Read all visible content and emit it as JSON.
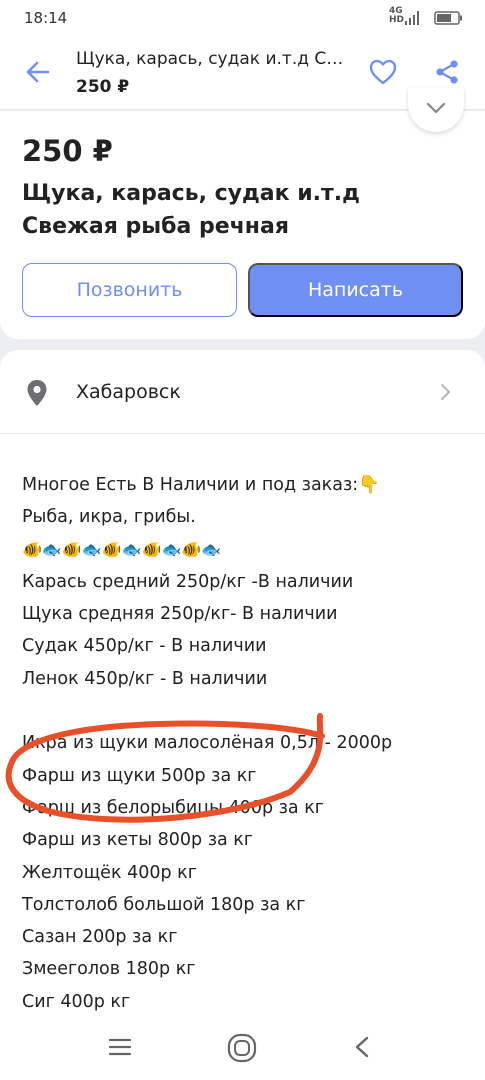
{
  "status_bar": {
    "time": "18:14",
    "network_top": "4G",
    "network_hd": "HD"
  },
  "app_bar": {
    "back_icon": "arrow-left-icon",
    "title": "Щука, карась, судак и.т.д Свежая рыба речная",
    "price": "250 ₽",
    "favorite_icon": "heart-outline-icon",
    "share_icon": "share-icon"
  },
  "listing": {
    "price": "250 ₽",
    "title": "Щука, карась, судак и.т.д Свежая рыба речная",
    "call_label": "Позвонить",
    "write_label": "Написать"
  },
  "location": {
    "icon": "location-pin-icon",
    "city": "Хабаровск"
  },
  "description": {
    "line1": "Многое Есть В Наличии и под заказ:👇",
    "line2": "Рыба, икра, грибы.",
    "emoji_line": "🐠🐟🐠🐟🐠🐟🐠🐟🐠🐟",
    "line3": "Карась средний 250р/кг -В наличии",
    "line4": "Щука средняя 250р/кг- В наличии",
    "line5": "Судак 450р/кг - В наличии",
    "line6": "Ленок 450р/кг - В наличии",
    "line7": "Икра из щуки малосолёная 0,5л - 2000р",
    "line8": "Фарш из щуки 500р за кг",
    "line9": "Фарш из белорыбицы 400р за кг",
    "line10": "Фарш из кеты 800р за кг",
    "line11": "Желтощёк 400р кг",
    "line12": "Толстолоб большой 180р за кг",
    "line13": "Сазан 200р за кг",
    "line14": "Змееголов 180р кг",
    "line15": "Сиг 400р кг"
  },
  "nav_bar": {
    "menu_icon": "menu-icon",
    "home_icon": "home-icon",
    "back_icon": "back-triangle-icon"
  },
  "colors": {
    "accent": "#6f8ff2",
    "annotation": "#e8502a",
    "background": "#eceef1"
  }
}
